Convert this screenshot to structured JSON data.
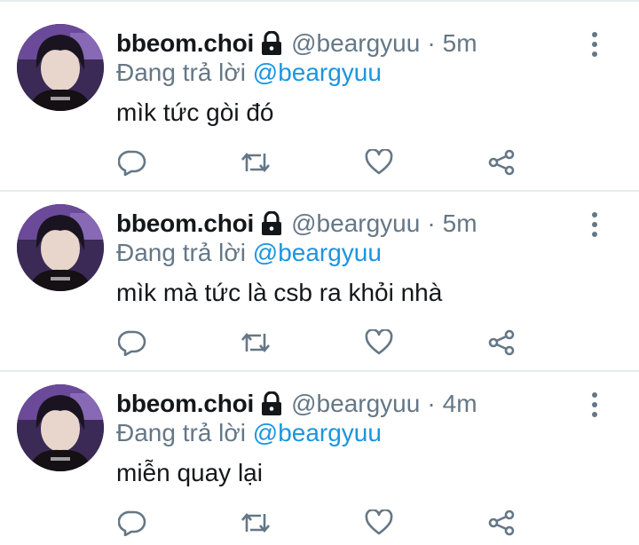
{
  "tweets": [
    {
      "name": "bbeom.choi",
      "handle": "@beargyuu",
      "separator": "·",
      "time": "5m",
      "replying_prefix": "Đang trả lời",
      "replying_to": "@beargyuu",
      "text": "mìk tức gòi đó"
    },
    {
      "name": "bbeom.choi",
      "handle": "@beargyuu",
      "separator": "·",
      "time": "5m",
      "replying_prefix": "Đang trả lời",
      "replying_to": "@beargyuu",
      "text": "mìk mà tức là csb ra khỏi nhà"
    },
    {
      "name": "bbeom.choi",
      "handle": "@beargyuu",
      "separator": "·",
      "time": "4m",
      "replying_prefix": "Đang trả lời",
      "replying_to": "@beargyuu",
      "text": "miễn quay lại"
    }
  ],
  "icons": {
    "lock": "lock-icon",
    "more": "more-vertical-icon",
    "reply": "reply-icon",
    "retweet": "retweet-icon",
    "like": "heart-icon",
    "share": "share-icon"
  },
  "colors": {
    "name": "#14171a",
    "secondary": "#657786",
    "link": "#1b95e0",
    "divider": "#e6ecf0"
  }
}
